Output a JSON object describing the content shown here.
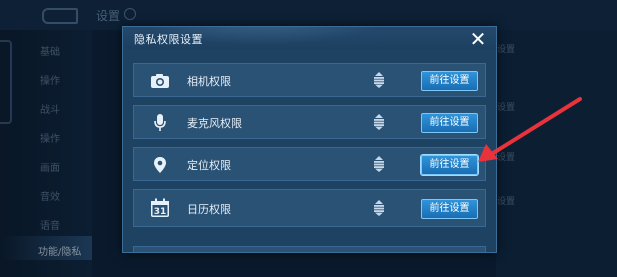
{
  "background": {
    "title": "设置",
    "sidebar_items": [
      "基础",
      "操作",
      "战斗",
      "操作",
      "画面",
      "音效",
      "语音",
      "功能/隐私"
    ],
    "right_items": [
      "设置",
      "设置",
      "设置",
      "设置"
    ]
  },
  "dialog": {
    "title": "隐私权限设置",
    "close_symbol": "✕",
    "rows": [
      {
        "icon": "camera-icon",
        "label": "相机权限",
        "button": "前往设置"
      },
      {
        "icon": "microphone-icon",
        "label": "麦克风权限",
        "button": "前往设置"
      },
      {
        "icon": "location-pin-icon",
        "label": "定位权限",
        "button": "前往设置"
      },
      {
        "icon": "calendar-icon",
        "label": "日历权限",
        "calendar_day": "31",
        "button": "前往设置"
      }
    ]
  },
  "annotation": {
    "type": "red-arrow",
    "points_to": "定位权限 前往设置",
    "color": "#e8323c"
  },
  "colors": {
    "dialog_bg": "#1e4262",
    "row_bg": "#2a5275",
    "button": "#2f94d9",
    "arrow": "#e8323c"
  }
}
